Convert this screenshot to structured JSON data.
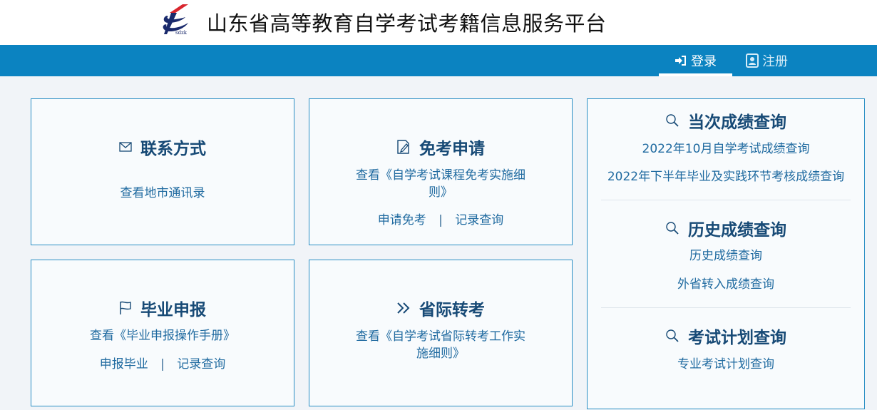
{
  "header": {
    "logo_text": "sdzk",
    "title": "山东省高等教育自学考试考籍信息服务平台"
  },
  "nav": {
    "login": "登录",
    "register": "注册"
  },
  "cards": {
    "contact": {
      "title": "联系方式",
      "link": "查看地市通讯录"
    },
    "exemption": {
      "title": "免考申请",
      "view_line1": "查看《自学考试课程免考实施细",
      "view_line2": "则》",
      "apply": "申请免考",
      "separator": "|",
      "record": "记录查询"
    },
    "graduation": {
      "title": "毕业申报",
      "view": "查看《毕业申报操作手册》",
      "apply": "申报毕业",
      "separator": "|",
      "record": "记录查询"
    },
    "transfer": {
      "title": "省际转考",
      "view_line1": "查看《自学考试省际转考工作实",
      "view_line2": "施细则》"
    },
    "query": {
      "current": {
        "title": "当次成绩查询",
        "link1": "2022年10月自学考试成绩查询",
        "link2": "2022年下半年毕业及实践环节考核成绩查询"
      },
      "history": {
        "title": "历史成绩查询",
        "link1": "历史成绩查询",
        "link2": "外省转入成绩查询"
      },
      "plan": {
        "title": "考试计划查询",
        "link1": "专业考试计划查询"
      }
    }
  },
  "colors": {
    "nav_bg": "#0b83c1",
    "card_border": "#2a8fc4",
    "title_text": "#174a76",
    "link_text": "#1f6aa0",
    "page_bg": "#f1f4f8"
  }
}
